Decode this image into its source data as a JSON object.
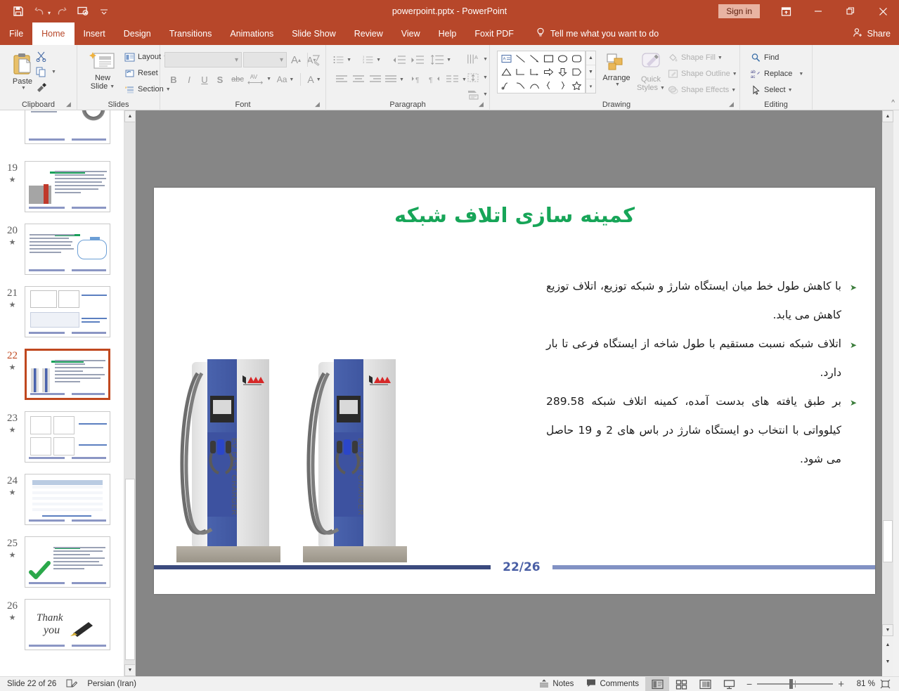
{
  "window": {
    "title": "powerpoint.pptx  -  PowerPoint",
    "signin_label": "Sign in",
    "minimize": "–",
    "restore": "❐",
    "close": "✕"
  },
  "quick_access": {
    "items": [
      {
        "name": "save-icon",
        "glyph": "save"
      },
      {
        "name": "undo-icon",
        "glyph": "undo"
      },
      {
        "name": "redo-icon",
        "glyph": "redo"
      },
      {
        "name": "start-presentation-icon",
        "glyph": "present"
      },
      {
        "name": "customize-qat-icon",
        "glyph": "chevron-down"
      }
    ]
  },
  "tabs": [
    {
      "label": "File",
      "active": false
    },
    {
      "label": "Home",
      "active": true
    },
    {
      "label": "Insert",
      "active": false
    },
    {
      "label": "Design",
      "active": false
    },
    {
      "label": "Transitions",
      "active": false
    },
    {
      "label": "Animations",
      "active": false
    },
    {
      "label": "Slide Show",
      "active": false
    },
    {
      "label": "Review",
      "active": false
    },
    {
      "label": "View",
      "active": false
    },
    {
      "label": "Help",
      "active": false
    },
    {
      "label": "Foxit PDF",
      "active": false
    }
  ],
  "tell_me": "Tell me what you want to do",
  "share_label": "Share",
  "ribbon": {
    "groups": [
      {
        "label": "Clipboard"
      },
      {
        "label": "Slides"
      },
      {
        "label": "Font"
      },
      {
        "label": "Paragraph"
      },
      {
        "label": "Drawing"
      },
      {
        "label": "Editing"
      }
    ],
    "clipboard": {
      "paste_label": "Paste",
      "cut_tip": "Cut",
      "copy_tip": "Copy",
      "format_painter_tip": "Format Painter"
    },
    "slides": {
      "new_slide_label": "New\nSlide",
      "new_slide_line1": "New",
      "new_slide_line2": "Slide",
      "layout_label": "Layout",
      "reset_label": "Reset",
      "section_label": "Section"
    },
    "font": {
      "font_name_value": "",
      "font_size_value": "",
      "increase_size": "A",
      "decrease_size": "A",
      "clear_formatting_tip": "Clear All Formatting",
      "bold": "B",
      "italic": "I",
      "underline": "U",
      "shadow": "S",
      "strikethrough": "abc",
      "char_spacing": "AV",
      "change_case": "Aa",
      "font_color": "A"
    },
    "drawing": {
      "arrange_label": "Arrange",
      "quick_styles_line1": "Quick",
      "quick_styles_line2": "Styles",
      "shape_fill": "Shape Fill",
      "shape_outline": "Shape Outline",
      "shape_effects": "Shape Effects"
    },
    "editing": {
      "find": "Find",
      "replace": "Replace",
      "select": "Select"
    }
  },
  "thumbnails": [
    {
      "number": "18",
      "star": "★",
      "selected": false,
      "kind": "text-circle"
    },
    {
      "number": "19",
      "star": "★",
      "selected": false,
      "kind": "car-charger"
    },
    {
      "number": "20",
      "star": "★",
      "selected": false,
      "kind": "diagram"
    },
    {
      "number": "21",
      "star": "★",
      "selected": false,
      "kind": "tables"
    },
    {
      "number": "22",
      "star": "★",
      "selected": true,
      "kind": "ev-chargers"
    },
    {
      "number": "23",
      "star": "★",
      "selected": false,
      "kind": "charts4"
    },
    {
      "number": "24",
      "star": "★",
      "selected": false,
      "kind": "bigtable"
    },
    {
      "number": "25",
      "star": "★",
      "selected": false,
      "kind": "check"
    },
    {
      "number": "26",
      "star": "★",
      "selected": false,
      "kind": "thankyou"
    }
  ],
  "slide": {
    "title": "کمینه سازی اتلاف شبکه",
    "bullets": [
      "با کاهش طول خط میان ایستگاه شارژ و شبکه توزیع، اتلاف توزیع کاهش می یابد.",
      "اتلاف شبکه نسبت مستقیم با طول شاخه از ایستگاه فرعی تا بار دارد.",
      "بر طبق یافته های بدست آمده،  کمینه اتلاف شبکه 289.58 کیلوواتی با انتخاب دو ایستگاه شارژ در باس های 2 و 19 حاصل می شود."
    ],
    "bullet_marker": "➤",
    "page_number": "22/26",
    "image_caption": "EV FAST CHARGER",
    "colors": {
      "title_green": "#17a558",
      "footer_dark": "#3b4a7e",
      "footer_light": "#8292c4",
      "page_number": "#4a5fa5"
    }
  },
  "status": {
    "slide_counter": "Slide 22 of 26",
    "language": "Persian (Iran)",
    "notes": "Notes",
    "comments": "Comments",
    "zoom_percent": "81 %",
    "zoom_out": "−",
    "zoom_in": "+",
    "views": [
      {
        "name": "normal-view",
        "active": true
      },
      {
        "name": "slide-sorter-view",
        "active": false
      },
      {
        "name": "reading-view",
        "active": false
      },
      {
        "name": "slide-show-view",
        "active": false
      }
    ]
  }
}
